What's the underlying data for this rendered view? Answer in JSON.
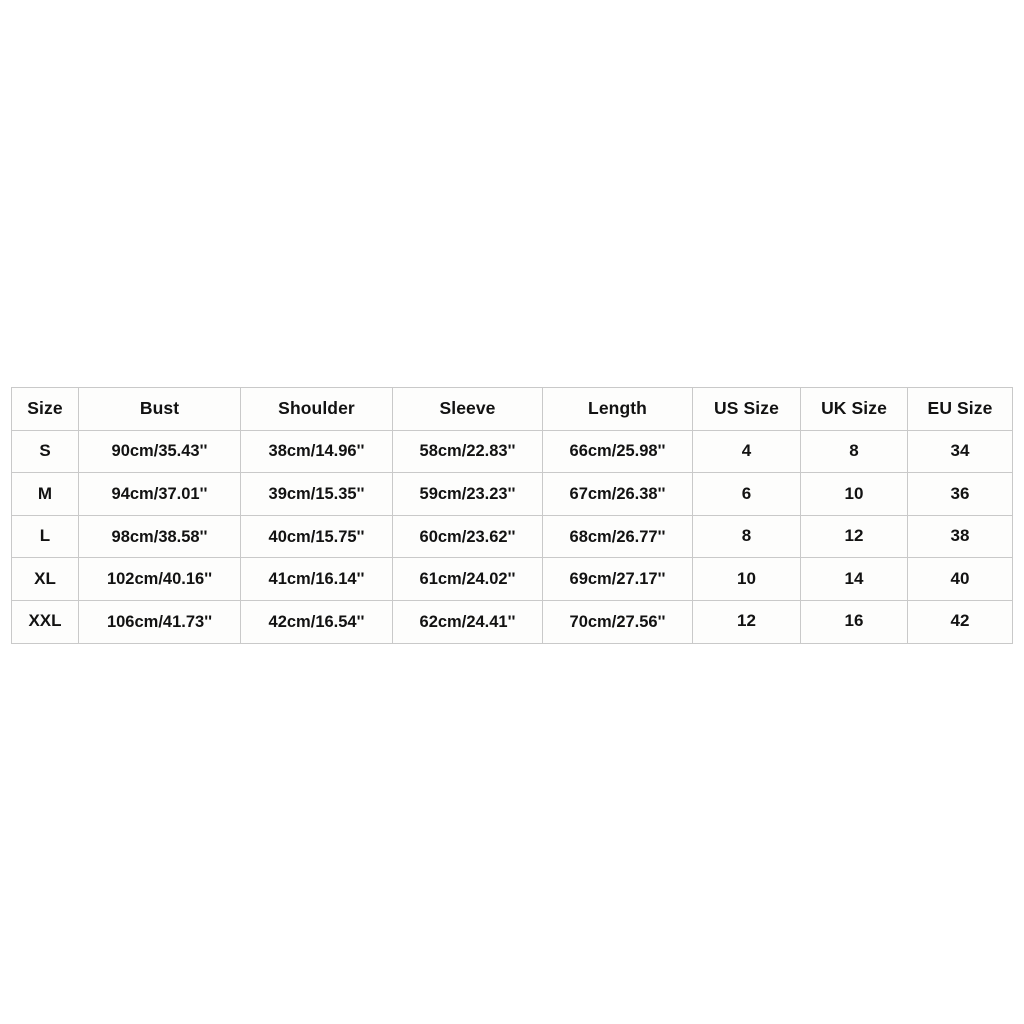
{
  "page": {
    "background_color": "#ffffff",
    "table_border_color": "#c9c9c9",
    "text_color": "#121212",
    "cell_background_color": "#fdfdfc"
  },
  "chart_data": {
    "type": "table",
    "title": "",
    "columns": [
      "Size",
      "Bust",
      "Shoulder",
      "Sleeve",
      "Length",
      "US Size",
      "UK Size",
      "EU Size"
    ],
    "rows": [
      [
        "S",
        "90cm/35.43''",
        "38cm/14.96''",
        "58cm/22.83''",
        "66cm/25.98''",
        "4",
        "8",
        "34"
      ],
      [
        "M",
        "94cm/37.01''",
        "39cm/15.35''",
        "59cm/23.23''",
        "67cm/26.38''",
        "6",
        "10",
        "36"
      ],
      [
        "L",
        "98cm/38.58''",
        "40cm/15.75''",
        "60cm/23.62''",
        "68cm/26.77''",
        "8",
        "12",
        "38"
      ],
      [
        "XL",
        "102cm/40.16''",
        "41cm/16.14''",
        "61cm/24.02''",
        "69cm/27.17''",
        "10",
        "14",
        "40"
      ],
      [
        "XXL",
        "106cm/41.73''",
        "42cm/16.54''",
        "62cm/24.41''",
        "70cm/27.56''",
        "12",
        "16",
        "42"
      ]
    ]
  },
  "size_table": {
    "headers": {
      "size": "Size",
      "bust": "Bust",
      "shoulder": "Shoulder",
      "sleeve": "Sleeve",
      "length": "Length",
      "us_size": "US Size",
      "uk_size": "UK Size",
      "eu_size": "EU Size"
    },
    "rows": [
      {
        "size": "S",
        "bust": "90cm/35.43''",
        "shoulder": "38cm/14.96''",
        "sleeve": "58cm/22.83''",
        "length": "66cm/25.98''",
        "us_size": "4",
        "uk_size": "8",
        "eu_size": "34"
      },
      {
        "size": "M",
        "bust": "94cm/37.01''",
        "shoulder": "39cm/15.35''",
        "sleeve": "59cm/23.23''",
        "length": "67cm/26.38''",
        "us_size": "6",
        "uk_size": "10",
        "eu_size": "36"
      },
      {
        "size": "L",
        "bust": "98cm/38.58''",
        "shoulder": "40cm/15.75''",
        "sleeve": "60cm/23.62''",
        "length": "68cm/26.77''",
        "us_size": "8",
        "uk_size": "12",
        "eu_size": "38"
      },
      {
        "size": "XL",
        "bust": "102cm/40.16''",
        "shoulder": "41cm/16.14''",
        "sleeve": "61cm/24.02''",
        "length": "69cm/27.17''",
        "us_size": "10",
        "uk_size": "14",
        "eu_size": "40"
      },
      {
        "size": "XXL",
        "bust": "106cm/41.73''",
        "shoulder": "42cm/16.54''",
        "sleeve": "62cm/24.41''",
        "length": "70cm/27.56''",
        "us_size": "12",
        "uk_size": "16",
        "eu_size": "42"
      }
    ]
  }
}
